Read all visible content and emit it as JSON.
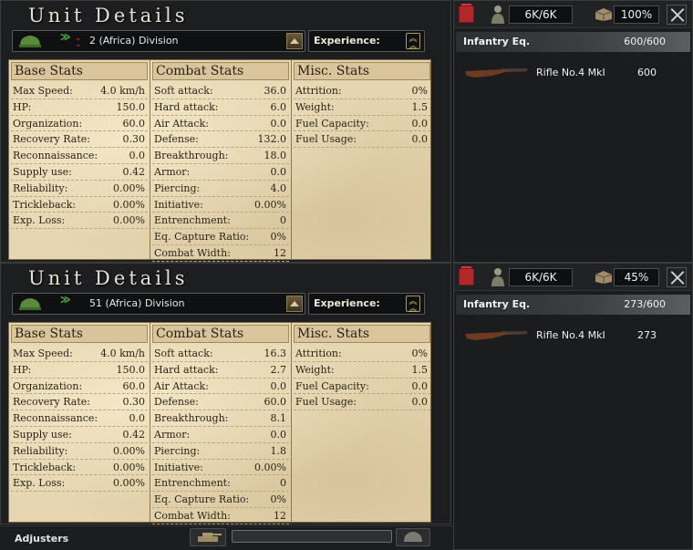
{
  "window_title": "Unit Details",
  "icons": [
    "helmet-icon",
    "rank-chevron-icon",
    "trash-icon",
    "soldier-icon",
    "equipment-crate-icon",
    "close-icon",
    "rifle-icon",
    "tank-icon",
    "experience-badge-icon"
  ],
  "colors": {
    "parchment": "#e6d6b1",
    "trash_red": "#b3282a",
    "rank_green": "#4fbf3a",
    "rank_red": "#c4282a"
  },
  "column_headers": {
    "base": "Base Stats",
    "combat": "Combat Stats",
    "misc": "Misc. Stats"
  },
  "experience_label": "Experience:",
  "equipment_category": "Infantry Eq.",
  "adjusters_label": "Adjusters",
  "divisions": [
    {
      "name": "2 (Africa) Division",
      "manpower": "6K/6K",
      "equipment_pct": "100%",
      "equipment_count": "600/600",
      "equipment_items": [
        {
          "name": "Rifle No.4 MkI",
          "qty": "600"
        }
      ],
      "base_stats": [
        {
          "label": "Max Speed:",
          "value": "4.0 km/h"
        },
        {
          "label": "HP:",
          "value": "150.0"
        },
        {
          "label": "Organization:",
          "value": "60.0"
        },
        {
          "label": "Recovery Rate:",
          "value": "0.30"
        },
        {
          "label": "Reconnaissance:",
          "value": "0.0"
        },
        {
          "label": "Supply use:",
          "value": "0.42"
        },
        {
          "label": "Reliability:",
          "value": "0.00%"
        },
        {
          "label": "Trickleback:",
          "value": "0.00%"
        },
        {
          "label": "Exp. Loss:",
          "value": "0.00%"
        }
      ],
      "combat_stats": [
        {
          "label": "Soft attack:",
          "value": "36.0"
        },
        {
          "label": "Hard attack:",
          "value": "6.0"
        },
        {
          "label": "Air Attack:",
          "value": "0.0"
        },
        {
          "label": "Defense:",
          "value": "132.0"
        },
        {
          "label": "Breakthrough:",
          "value": "18.0"
        },
        {
          "label": "Armor:",
          "value": "0.0"
        },
        {
          "label": "Piercing:",
          "value": "4.0"
        },
        {
          "label": "Initiative:",
          "value": "0.00%"
        },
        {
          "label": "Entrenchment:",
          "value": "0"
        },
        {
          "label": "Eq. Capture Ratio:",
          "value": "0%"
        },
        {
          "label": "Combat Width:",
          "value": "12"
        }
      ],
      "misc_stats": [
        {
          "label": "Attrition:",
          "value": "0%"
        },
        {
          "label": "Weight:",
          "value": "1.5"
        },
        {
          "label": "Fuel Capacity:",
          "value": "0.0"
        },
        {
          "label": "Fuel Usage:",
          "value": "0.0"
        }
      ]
    },
    {
      "name": "51 (Africa) Division",
      "manpower": "6K/6K",
      "equipment_pct": "45%",
      "equipment_count": "273/600",
      "equipment_items": [
        {
          "name": "Rifle No.4 MkI",
          "qty": "273"
        }
      ],
      "base_stats": [
        {
          "label": "Max Speed:",
          "value": "4.0 km/h"
        },
        {
          "label": "HP:",
          "value": "150.0"
        },
        {
          "label": "Organization:",
          "value": "60.0"
        },
        {
          "label": "Recovery Rate:",
          "value": "0.30"
        },
        {
          "label": "Reconnaissance:",
          "value": "0.0"
        },
        {
          "label": "Supply use:",
          "value": "0.42"
        },
        {
          "label": "Reliability:",
          "value": "0.00%"
        },
        {
          "label": "Trickleback:",
          "value": "0.00%"
        },
        {
          "label": "Exp. Loss:",
          "value": "0.00%"
        }
      ],
      "combat_stats": [
        {
          "label": "Soft attack:",
          "value": "16.3"
        },
        {
          "label": "Hard attack:",
          "value": "2.7"
        },
        {
          "label": "Air Attack:",
          "value": "0.0"
        },
        {
          "label": "Defense:",
          "value": "60.0"
        },
        {
          "label": "Breakthrough:",
          "value": "8.1"
        },
        {
          "label": "Armor:",
          "value": "0.0"
        },
        {
          "label": "Piercing:",
          "value": "1.8"
        },
        {
          "label": "Initiative:",
          "value": "0.00%"
        },
        {
          "label": "Entrenchment:",
          "value": "0"
        },
        {
          "label": "Eq. Capture Ratio:",
          "value": "0%"
        },
        {
          "label": "Combat Width:",
          "value": "12"
        }
      ],
      "misc_stats": [
        {
          "label": "Attrition:",
          "value": "0%"
        },
        {
          "label": "Weight:",
          "value": "1.5"
        },
        {
          "label": "Fuel Capacity:",
          "value": "0.0"
        },
        {
          "label": "Fuel Usage:",
          "value": "0.0"
        }
      ]
    }
  ]
}
